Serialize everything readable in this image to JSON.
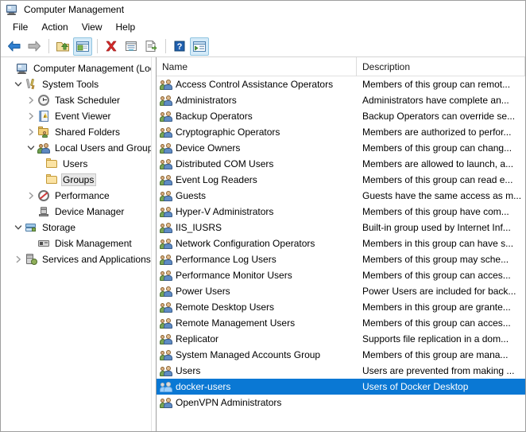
{
  "window": {
    "title": "Computer Management",
    "icon": "computer-monitor-icon"
  },
  "menu": {
    "items": [
      {
        "label": "File"
      },
      {
        "label": "Action"
      },
      {
        "label": "View"
      },
      {
        "label": "Help"
      }
    ]
  },
  "toolbar": {
    "buttons": [
      {
        "name": "back-button",
        "icon": "arrow-left-icon",
        "active": false
      },
      {
        "name": "forward-button",
        "icon": "arrow-right-icon",
        "active": false
      },
      {
        "name": "up-one-level-button",
        "icon": "folder-up-icon",
        "active": false
      },
      {
        "name": "show-hide-console-tree-button",
        "icon": "console-tree-icon",
        "active": true
      },
      {
        "name": "delete-button",
        "icon": "red-x-icon",
        "active": false
      },
      {
        "name": "properties-button",
        "icon": "properties-icon",
        "active": false
      },
      {
        "name": "export-list-button",
        "icon": "export-list-icon",
        "active": false
      },
      {
        "name": "help-button",
        "icon": "question-mark-icon",
        "active": false
      },
      {
        "name": "show-hide-action-pane-button",
        "icon": "action-pane-icon",
        "active": true
      }
    ]
  },
  "tree": {
    "nodes": [
      {
        "label": "Computer Management (Local",
        "indent": 0,
        "twisty": "none",
        "icon": "computer-monitor-icon",
        "selected": false
      },
      {
        "label": "System Tools",
        "indent": 1,
        "twisty": "expanded",
        "icon": "system-tools-icon",
        "selected": false
      },
      {
        "label": "Task Scheduler",
        "indent": 2,
        "twisty": "collapsed",
        "icon": "clock-icon",
        "selected": false
      },
      {
        "label": "Event Viewer",
        "indent": 2,
        "twisty": "collapsed",
        "icon": "event-viewer-icon",
        "selected": false
      },
      {
        "label": "Shared Folders",
        "indent": 2,
        "twisty": "collapsed",
        "icon": "shared-folders-icon",
        "selected": false
      },
      {
        "label": "Local Users and Groups",
        "indent": 2,
        "twisty": "expanded",
        "icon": "users-groups-icon",
        "selected": false
      },
      {
        "label": "Users",
        "indent": 3,
        "twisty": "none",
        "icon": "folder-icon",
        "selected": false
      },
      {
        "label": "Groups",
        "indent": 3,
        "twisty": "none",
        "icon": "folder-icon",
        "selected": true
      },
      {
        "label": "Performance",
        "indent": 2,
        "twisty": "collapsed",
        "icon": "performance-icon",
        "selected": false
      },
      {
        "label": "Device Manager",
        "indent": 2,
        "twisty": "none",
        "icon": "device-manager-icon",
        "selected": false
      },
      {
        "label": "Storage",
        "indent": 1,
        "twisty": "expanded",
        "icon": "storage-icon",
        "selected": false
      },
      {
        "label": "Disk Management",
        "indent": 2,
        "twisty": "none",
        "icon": "disk-management-icon",
        "selected": false
      },
      {
        "label": "Services and Applications",
        "indent": 1,
        "twisty": "collapsed",
        "icon": "services-apps-icon",
        "selected": false
      }
    ]
  },
  "list": {
    "columns": [
      {
        "label": "Name"
      },
      {
        "label": "Description"
      }
    ],
    "rows": [
      {
        "name": "Access Control Assistance Operators",
        "description": "Members of this group can remot...",
        "icon": "group-icon",
        "selected": false
      },
      {
        "name": "Administrators",
        "description": "Administrators have complete an...",
        "icon": "group-icon",
        "selected": false
      },
      {
        "name": "Backup Operators",
        "description": "Backup Operators can override se...",
        "icon": "group-icon",
        "selected": false
      },
      {
        "name": "Cryptographic Operators",
        "description": "Members are authorized to perfor...",
        "icon": "group-icon",
        "selected": false
      },
      {
        "name": "Device Owners",
        "description": "Members of this group can chang...",
        "icon": "group-icon",
        "selected": false
      },
      {
        "name": "Distributed COM Users",
        "description": "Members are allowed to launch, a...",
        "icon": "group-icon",
        "selected": false
      },
      {
        "name": "Event Log Readers",
        "description": "Members of this group can read e...",
        "icon": "group-icon",
        "selected": false
      },
      {
        "name": "Guests",
        "description": "Guests have the same access as m...",
        "icon": "group-icon",
        "selected": false
      },
      {
        "name": "Hyper-V Administrators",
        "description": "Members of this group have com...",
        "icon": "group-icon",
        "selected": false
      },
      {
        "name": "IIS_IUSRS",
        "description": "Built-in group used by Internet Inf...",
        "icon": "group-icon",
        "selected": false
      },
      {
        "name": "Network Configuration Operators",
        "description": "Members in this group can have s...",
        "icon": "group-icon",
        "selected": false
      },
      {
        "name": "Performance Log Users",
        "description": "Members of this group may sche...",
        "icon": "group-icon",
        "selected": false
      },
      {
        "name": "Performance Monitor Users",
        "description": "Members of this group can acces...",
        "icon": "group-icon",
        "selected": false
      },
      {
        "name": "Power Users",
        "description": "Power Users are included for back...",
        "icon": "group-icon",
        "selected": false
      },
      {
        "name": "Remote Desktop Users",
        "description": "Members in this group are grante...",
        "icon": "group-icon",
        "selected": false
      },
      {
        "name": "Remote Management Users",
        "description": "Members of this group can acces...",
        "icon": "group-icon",
        "selected": false
      },
      {
        "name": "Replicator",
        "description": "Supports file replication in a dom...",
        "icon": "group-icon",
        "selected": false
      },
      {
        "name": "System Managed Accounts Group",
        "description": "Members of this group are mana...",
        "icon": "group-icon",
        "selected": false
      },
      {
        "name": "Users",
        "description": "Users are prevented from making ...",
        "icon": "group-icon",
        "selected": false
      },
      {
        "name": "docker-users",
        "description": "Users of Docker Desktop",
        "icon": "group-icon",
        "selected": true
      },
      {
        "name": "OpenVPN Administrators",
        "description": "",
        "icon": "group-icon",
        "selected": false
      }
    ]
  },
  "colors": {
    "selection_blue": "#0a78d4",
    "toolbar_active": "#d4eaf8",
    "window_bg": "#ffffff"
  }
}
